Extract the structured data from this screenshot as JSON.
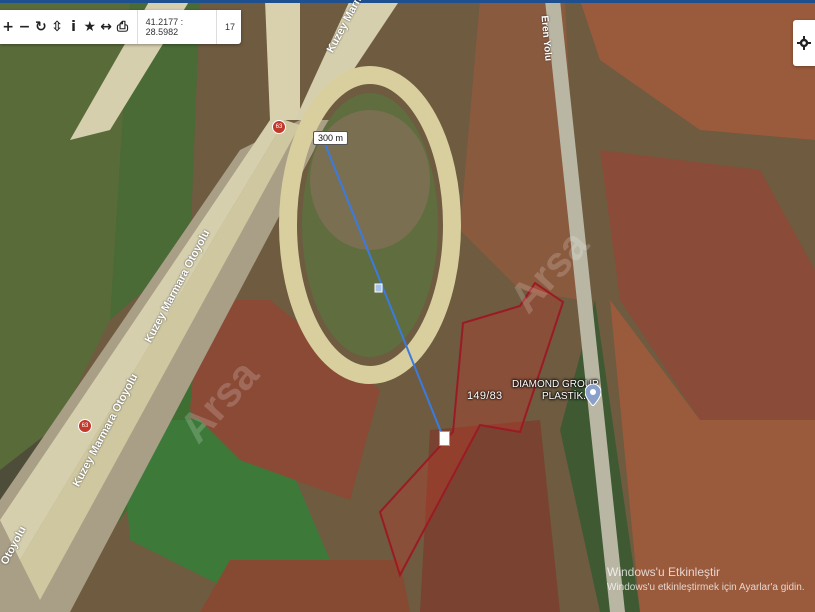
{
  "toolbar": {
    "tools": [
      {
        "name": "zoom-in-icon",
        "glyph": "+"
      },
      {
        "name": "zoom-out-icon",
        "glyph": "−"
      },
      {
        "name": "rotate-icon",
        "glyph": "↻"
      },
      {
        "name": "navigate-icon",
        "glyph": "⇳"
      },
      {
        "name": "info-icon",
        "glyph": "i"
      },
      {
        "name": "star-icon",
        "glyph": "★"
      },
      {
        "name": "measure-icon",
        "glyph": "↔"
      },
      {
        "name": "print-icon",
        "glyph": "⎙"
      }
    ],
    "coordinates": "41.2177 : 28.5982",
    "zoom_level": "17"
  },
  "map": {
    "distance_label": "300 m",
    "parcel_label": "149/83",
    "poi_label_line1": "DIAMOND GROUP",
    "poi_label_line2": "PLASTİK...",
    "roads": {
      "highway_1": "Kuzey Marmara Otoyolu",
      "highway_2": "Kuzey Marmara Otoyolu",
      "highway_3": "Otoyolu",
      "ramp": "Kuzey Marmara Otoyolu",
      "side_road": "Eren Yolu"
    },
    "route_shield": "63",
    "watermark": "Arsa"
  },
  "overlay": {
    "activation_title": "Windows'u Etkinleştir",
    "activation_sub": "Windows'u etkinleştirmek için Ayarlar'a gidin."
  },
  "colors": {
    "parcel_stroke": "#9b1b25",
    "parcel_fill": "#c0392b",
    "measure_line": "#3b7be0",
    "topbar": "#1e4f8f"
  }
}
